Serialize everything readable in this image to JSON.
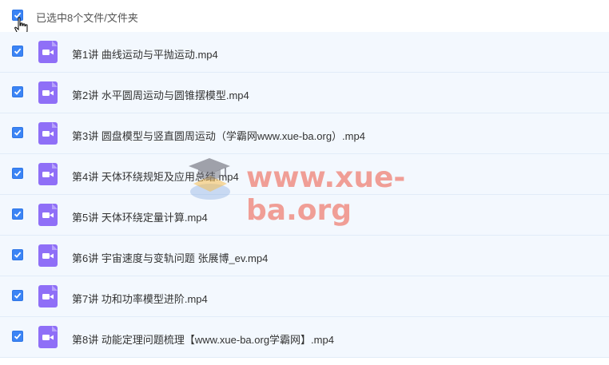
{
  "header": {
    "selection_text": "已选中8个文件/文件夹"
  },
  "files": [
    {
      "name": "第1讲 曲线运动与平抛运动.mp4"
    },
    {
      "name": "第2讲 水平圆周运动与圆锥摆模型.mp4"
    },
    {
      "name": "第3讲 圆盘模型与竖直圆周运动（学霸网www.xue-ba.org）.mp4"
    },
    {
      "name": "第4讲 天体环绕规矩及应用总结.mp4"
    },
    {
      "name": "第5讲 天体环绕定量计算.mp4"
    },
    {
      "name": "第6讲 宇宙速度与变轨问题 张展博_ev.mp4"
    },
    {
      "name": "第7讲 功和功率模型进阶.mp4"
    },
    {
      "name": "第8讲 动能定理问题梳理【www.xue-ba.org学霸网】.mp4"
    }
  ],
  "watermark": {
    "text": "www.xue-ba.org"
  },
  "colors": {
    "checkbox": "#3b84f5",
    "video_icon": "#8f6ff7",
    "row_bg": "#f3f8fe"
  },
  "icons": {
    "file": "video-file-icon",
    "check": "check-icon",
    "cursor": "hand-pointer-icon"
  }
}
